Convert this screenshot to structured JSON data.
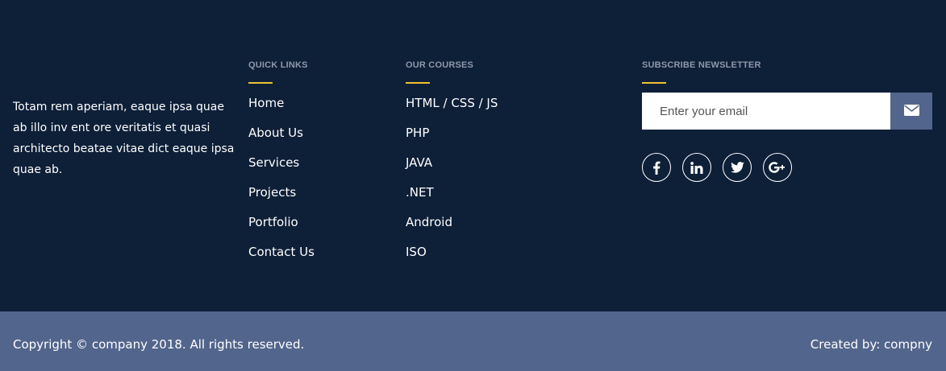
{
  "about": {
    "text": "Totam rem aperiam, eaque ipsa quae ab illo inv ent ore veritatis et quasi architecto beatae vitae dict eaque ipsa quae ab."
  },
  "quick_links": {
    "heading": "QUICK LINKS",
    "items": [
      "Home",
      "About Us",
      "Services",
      "Projects",
      "Portfolio",
      "Contact Us"
    ]
  },
  "courses": {
    "heading": "OUR COURSES",
    "items": [
      "HTML / CSS / JS",
      "PHP",
      "JAVA",
      ".NET",
      "Android",
      "ISO"
    ]
  },
  "newsletter": {
    "heading": "SUBSCRIBE NEWSLETTER",
    "email_placeholder": "Enter your email",
    "email_value": "",
    "submit_icon": "envelope-icon",
    "social": [
      "facebook-icon",
      "linkedin-icon",
      "twitter-icon",
      "google-plus-icon"
    ]
  },
  "bottom": {
    "copyright": "Copyright © company 2018. All rights reserved.",
    "created_by": "Created by: compny"
  },
  "colors": {
    "footer_bg": "#0e1f38",
    "bottom_bar_bg": "#52658c",
    "accent_underline": "#f0c330",
    "heading_text": "#8f98a8",
    "text": "#ffffff"
  }
}
